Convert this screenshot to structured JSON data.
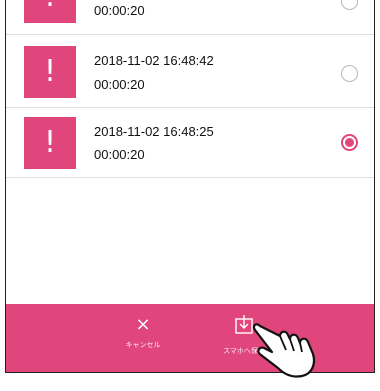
{
  "list": {
    "items": [
      {
        "datetime": "",
        "duration": "00:00:20",
        "selected": false
      },
      {
        "datetime": "2018-11-02 16:48:42",
        "duration": "00:00:20",
        "selected": false
      },
      {
        "datetime": "2018-11-02 16:48:25",
        "duration": "00:00:20",
        "selected": true
      }
    ],
    "thumb_glyph": "!"
  },
  "bottom_bar": {
    "cancel_icon": "×",
    "cancel_label": "キャンセル",
    "save_icon": "download-icon",
    "save_label": "スマホへ保存"
  },
  "colors": {
    "accent": "#e0457b",
    "divider": "#dddddd"
  }
}
